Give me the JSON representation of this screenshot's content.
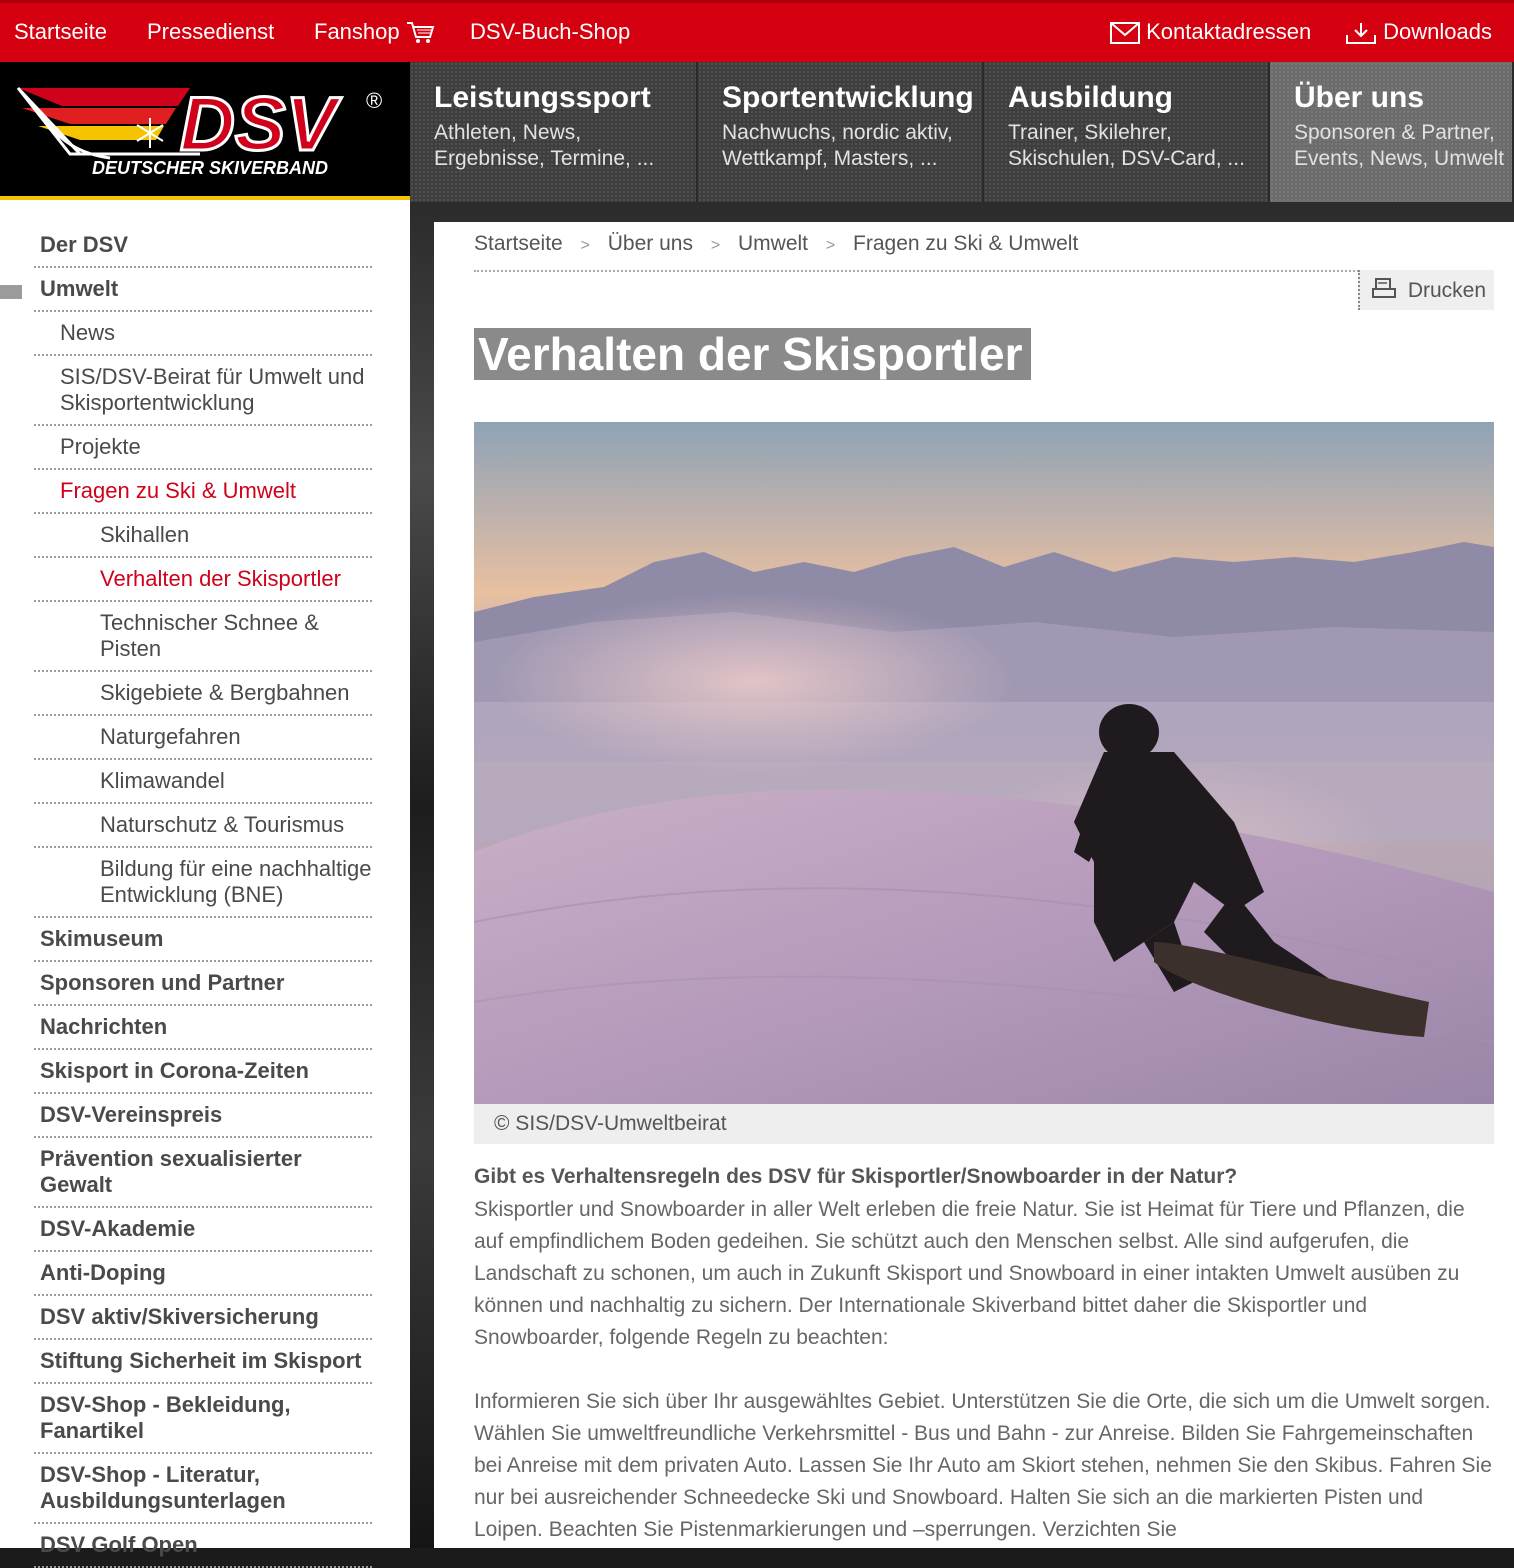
{
  "topbar": {
    "links": [
      "Startseite",
      "Pressedienst",
      "Fanshop",
      "DSV-Buch-Shop"
    ],
    "contact": "Kontaktadressen",
    "downloads": "Downloads"
  },
  "logo": {
    "wordmark": "DSV",
    "subtitle": "DEUTSCHER SKIVERBAND",
    "registered": "®"
  },
  "mainnav": [
    {
      "title": "Leistungssport",
      "line1": "Athleten, News,",
      "line2": "Ergebnisse, Termine, ..."
    },
    {
      "title": "Sportentwicklung",
      "line1": "Nachwuchs, nordic aktiv,",
      "line2": "Wettkampf, Masters, ..."
    },
    {
      "title": "Ausbildung",
      "line1": "Trainer, Skilehrer,",
      "line2": "Skischulen, DSV-Card, ..."
    },
    {
      "title": "Über uns",
      "line1": "Sponsoren & Partner,",
      "line2": "Events, News, Umwelt"
    }
  ],
  "sidebar": {
    "items": [
      {
        "label": "Der DSV"
      },
      {
        "label": "Umwelt"
      },
      {
        "label": "News"
      },
      {
        "label": "SIS/DSV-Beirat für Umwelt und Skisportentwicklung"
      },
      {
        "label": "Projekte"
      },
      {
        "label": "Fragen zu Ski & Umwelt"
      },
      {
        "label": "Skihallen"
      },
      {
        "label": "Verhalten der Skisportler"
      },
      {
        "label": "Technischer Schnee & Pisten"
      },
      {
        "label": "Skigebiete & Bergbahnen"
      },
      {
        "label": "Naturgefahren"
      },
      {
        "label": "Klimawandel"
      },
      {
        "label": "Naturschutz & Tourismus"
      },
      {
        "label": "Bildung für eine nachhaltige Entwicklung (BNE)"
      },
      {
        "label": "Skimuseum"
      },
      {
        "label": "Sponsoren und Partner"
      },
      {
        "label": "Nachrichten"
      },
      {
        "label": "Skisport in Corona-Zeiten"
      },
      {
        "label": "DSV-Vereinspreis"
      },
      {
        "label": "Prävention sexualisierter Gewalt"
      },
      {
        "label": "DSV-Akademie"
      },
      {
        "label": "Anti-Doping"
      },
      {
        "label": "DSV aktiv/Skiversicherung"
      },
      {
        "label": "Stiftung Sicherheit im Skisport"
      },
      {
        "label": "DSV-Shop - Bekleidung, Fanartikel"
      },
      {
        "label": "DSV-Shop - Literatur, Ausbildungsunterlagen"
      },
      {
        "label": "DSV Golf Open"
      }
    ]
  },
  "breadcrumb": [
    "Startseite",
    "Über uns",
    "Umwelt",
    "Fragen zu Ski & Umwelt"
  ],
  "print_label": "Drucken",
  "page_title": "Verhalten der Skisportler",
  "caption": "© SIS/DSV-Umweltbeirat",
  "question": "Gibt es Verhaltensregeln des DSV für Skisportler/Snowboarder in der Natur?",
  "paragraph1": "Skisportler und Snowboarder in aller Welt erleben die freie Natur. Sie ist Heimat für Tiere und Pflanzen, die auf empfindlichem Boden gedeihen. Sie schützt auch den Menschen selbst. Alle sind aufgerufen, die Landschaft zu schonen, um auch in Zukunft Skisport und Snowboard in einer intakten Umwelt ausüben zu können und nachhaltig zu sichern. Der Internationale Skiverband bittet daher die Skisportler und Snowboarder, folgende Regeln zu beachten:",
  "paragraph2": "Informieren Sie sich über Ihr ausgewähltes Gebiet. Unterstützen Sie die Orte, die sich um die Umwelt sorgen. Wählen Sie umweltfreundliche Verkehrsmittel - Bus und Bahn - zur Anreise. Bilden Sie Fahrgemeinschaften bei Anreise mit dem privaten Auto. Lassen Sie Ihr Auto am Skiort stehen, nehmen Sie den Skibus. Fahren Sie nur bei ausreichender Schneedecke Ski und Snowboard. Halten Sie sich an die markierten Pisten und Loipen. Beachten Sie Pistenmarkierungen und –sperrungen. Verzichten Sie",
  "colors": {
    "brand_red": "#d4000f",
    "active_red": "#d0021b",
    "gold": "#f5c400"
  }
}
